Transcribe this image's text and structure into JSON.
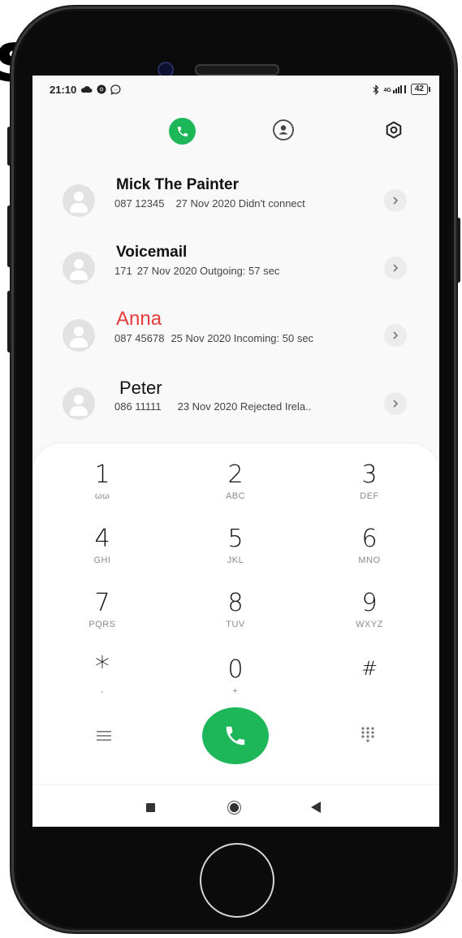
{
  "corner_glyph": "s",
  "status_bar": {
    "time": "21:10",
    "left_icons": [
      "cloud-icon",
      "chrome-icon",
      "messenger-icon"
    ],
    "right_icons": [
      "bluetooth-icon",
      "4g-signal-icon"
    ],
    "network_label": "4G",
    "battery": "42"
  },
  "top_tabs": {
    "active": "phone",
    "icons": [
      "phone-icon",
      "contacts-icon",
      "settings-icon"
    ],
    "accent_color": "#1db75a"
  },
  "calls": [
    {
      "name": "Mick The Painter",
      "number": "087 12345",
      "detail": "27 Nov 2020 Didn't connect",
      "style": "bold"
    },
    {
      "name": "Voicemail",
      "number": "171",
      "detail": "27 Nov 2020 Outgoing: 57 sec",
      "style": "bold"
    },
    {
      "name": "Anna",
      "number": "087 45678",
      "detail": "25 Nov 2020 Incoming: 50 sec",
      "style": "missed",
      "name_color": "#e33b3b"
    },
    {
      "name": "Peter",
      "number": "086 11111",
      "detail": "23 Nov 2020 Rejected  Irela..",
      "style": "light"
    }
  ],
  "dialpad": {
    "keys": [
      {
        "digit": "1",
        "letters": "ωω"
      },
      {
        "digit": "2",
        "letters": "ABC"
      },
      {
        "digit": "3",
        "letters": "DEF"
      },
      {
        "digit": "4",
        "letters": "GHI"
      },
      {
        "digit": "5",
        "letters": "JKL"
      },
      {
        "digit": "6",
        "letters": "MNO"
      },
      {
        "digit": "7",
        "letters": "PQRS"
      },
      {
        "digit": "8",
        "letters": "TUV"
      },
      {
        "digit": "9",
        "letters": "WXYZ"
      },
      {
        "digit": "*",
        "letters": ","
      },
      {
        "digit": "0",
        "letters": "+"
      },
      {
        "digit": "#",
        "letters": ""
      }
    ],
    "call_button_color": "#1db75a"
  },
  "nav_bar": {
    "icons": [
      "recents-square-icon",
      "home-circle-icon",
      "back-triangle-icon"
    ]
  }
}
